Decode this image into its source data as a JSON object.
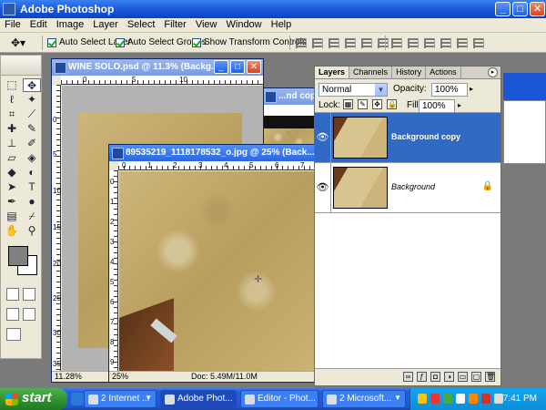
{
  "app": {
    "title": "Adobe Photoshop"
  },
  "window_controls": {
    "minimize": "_",
    "maximize": "□",
    "close": "✕"
  },
  "menu": [
    "File",
    "Edit",
    "Image",
    "Layer",
    "Select",
    "Filter",
    "View",
    "Window",
    "Help"
  ],
  "options_bar": {
    "auto_select_layer": "Auto Select Layer",
    "auto_select_groups": "Auto Select Groups",
    "show_transform_controls": "Show Transform Controls"
  },
  "documents": [
    {
      "title": "WINE SOLO.psd @ 11.3% (Backg...",
      "zoom": "11.28%"
    },
    {
      "title": "...nd copy,...",
      "zoom": ""
    },
    {
      "title": "89535219_1118178532_o.jpg @ 25% (Back...",
      "zoom": "25%",
      "doc_info": "Doc: 5.49M/11.0M"
    }
  ],
  "layers_panel": {
    "tabs": [
      "Layers",
      "Channels",
      "History",
      "Actions"
    ],
    "blend_mode": "Normal",
    "opacity_label": "Opacity:",
    "opacity": "100%",
    "lock_label": "Lock:",
    "fill_label": "Fill:",
    "fill": "100%",
    "layers": [
      {
        "name": "Background copy",
        "selected": true,
        "visible": true
      },
      {
        "name": "Background",
        "selected": false,
        "visible": true,
        "locked": true
      }
    ]
  },
  "ruler_numbers": {
    "top_small": [
      "0",
      "5",
      "10"
    ],
    "left_small": [
      "0",
      "5",
      "10",
      "15",
      "20",
      "25",
      "30",
      "35"
    ],
    "top_big": [
      "0",
      "1",
      "2",
      "3",
      "4",
      "5",
      "6",
      "7"
    ],
    "left_big": [
      "0",
      "1",
      "2",
      "3",
      "4",
      "5",
      "6",
      "7",
      "8",
      "9"
    ]
  },
  "taskbar": {
    "start": "start",
    "tasks": [
      "2 Internet ...",
      "Adobe Phot...",
      "Editor - Phot...",
      "2 Microsoft..."
    ],
    "clock": "7:41 PM"
  },
  "colors": {
    "title_bar": "#1a56d8",
    "selection": "#316ac5",
    "start_button": "#2d8f2d",
    "foreground_color": "#808080",
    "background_color": "#ffffff"
  }
}
